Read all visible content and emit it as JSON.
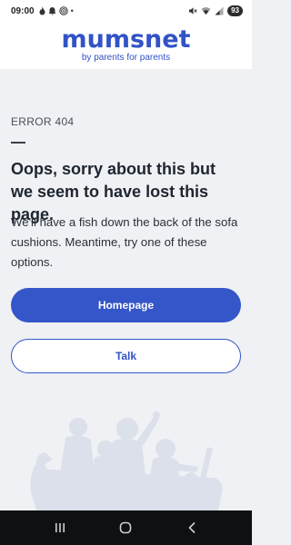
{
  "status_bar": {
    "time": "09:00",
    "battery": "93",
    "dot": "•"
  },
  "header": {
    "logo": "mumsnet",
    "tagline": "by parents for parents"
  },
  "error": {
    "code": "ERROR 404",
    "headline": "Oops, sorry about this but we seem to have lost this page.",
    "body": "We'll have a fish down the back of the sofa cushions. Meantime, try one of these options."
  },
  "buttons": {
    "homepage": "Homepage",
    "talk": "Talk"
  },
  "colors": {
    "brand": "#3153c6",
    "background": "#eff1f4",
    "navbar": "#0f1011"
  },
  "icons": [
    "fire-icon",
    "alarm-icon",
    "wifi-call-icon",
    "mute-icon",
    "wifi-icon",
    "signal-icon",
    "recents-icon",
    "home-icon",
    "back-icon"
  ]
}
